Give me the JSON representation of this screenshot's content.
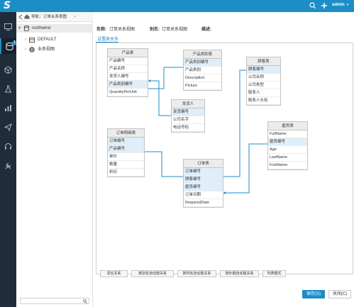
{
  "header": {
    "user": "admin"
  },
  "rail": {
    "badge": "1"
  },
  "tabs": {
    "nav": "导航",
    "current": "订单关系视图"
  },
  "tree": {
    "root": "northwind",
    "items": [
      "DEFAULT",
      "业务视图"
    ]
  },
  "form": {
    "name_label": "名称:",
    "name_value": "订单关系视图",
    "alias_label": "别名:",
    "alias_value": "订单关系视图",
    "desc_label": "描述:"
  },
  "subtab": "设置表关系",
  "tables": [
    {
      "title": "产品表",
      "fields": [
        "产品编号",
        "产品名称",
        "发货人编号",
        "产品类别编号",
        "QuantityPerUnit"
      ]
    },
    {
      "title": "产品类别表",
      "fields": [
        "产品类别编号",
        "产品类别",
        "Description",
        "Picture"
      ]
    },
    {
      "title": "顾客表",
      "fields": [
        "顾客编号",
        "公司名称",
        "公司类型",
        "联系人",
        "联系人头衔"
      ]
    },
    {
      "title": "发货人",
      "fields": [
        "发货编号",
        "公司名字",
        "电话号码"
      ]
    },
    {
      "title": "订单明细表",
      "fields": [
        "订单编号",
        "产品编号",
        "单价",
        "数量",
        "折扣"
      ]
    },
    {
      "title": "雇员表",
      "fields": [
        "FullName",
        "雇员编号",
        "Age",
        "LastName",
        "FirstName"
      ]
    },
    {
      "title": "订单表",
      "fields": [
        "订单编号",
        "顾客编号",
        "雇员编号",
        "订单日期",
        "RequiredDate"
      ]
    }
  ],
  "toolbar": [
    "清空关系",
    "按别名自动建关系",
    "按列名自动建关系",
    "按外键自动建关系",
    "列表模式"
  ],
  "buttons": {
    "save": "保存(S)",
    "close": "关闭(C)"
  },
  "colors": {
    "accent": "#1c8ec6",
    "rail": "#1f2d3a",
    "highlight": "#dfeef8"
  }
}
